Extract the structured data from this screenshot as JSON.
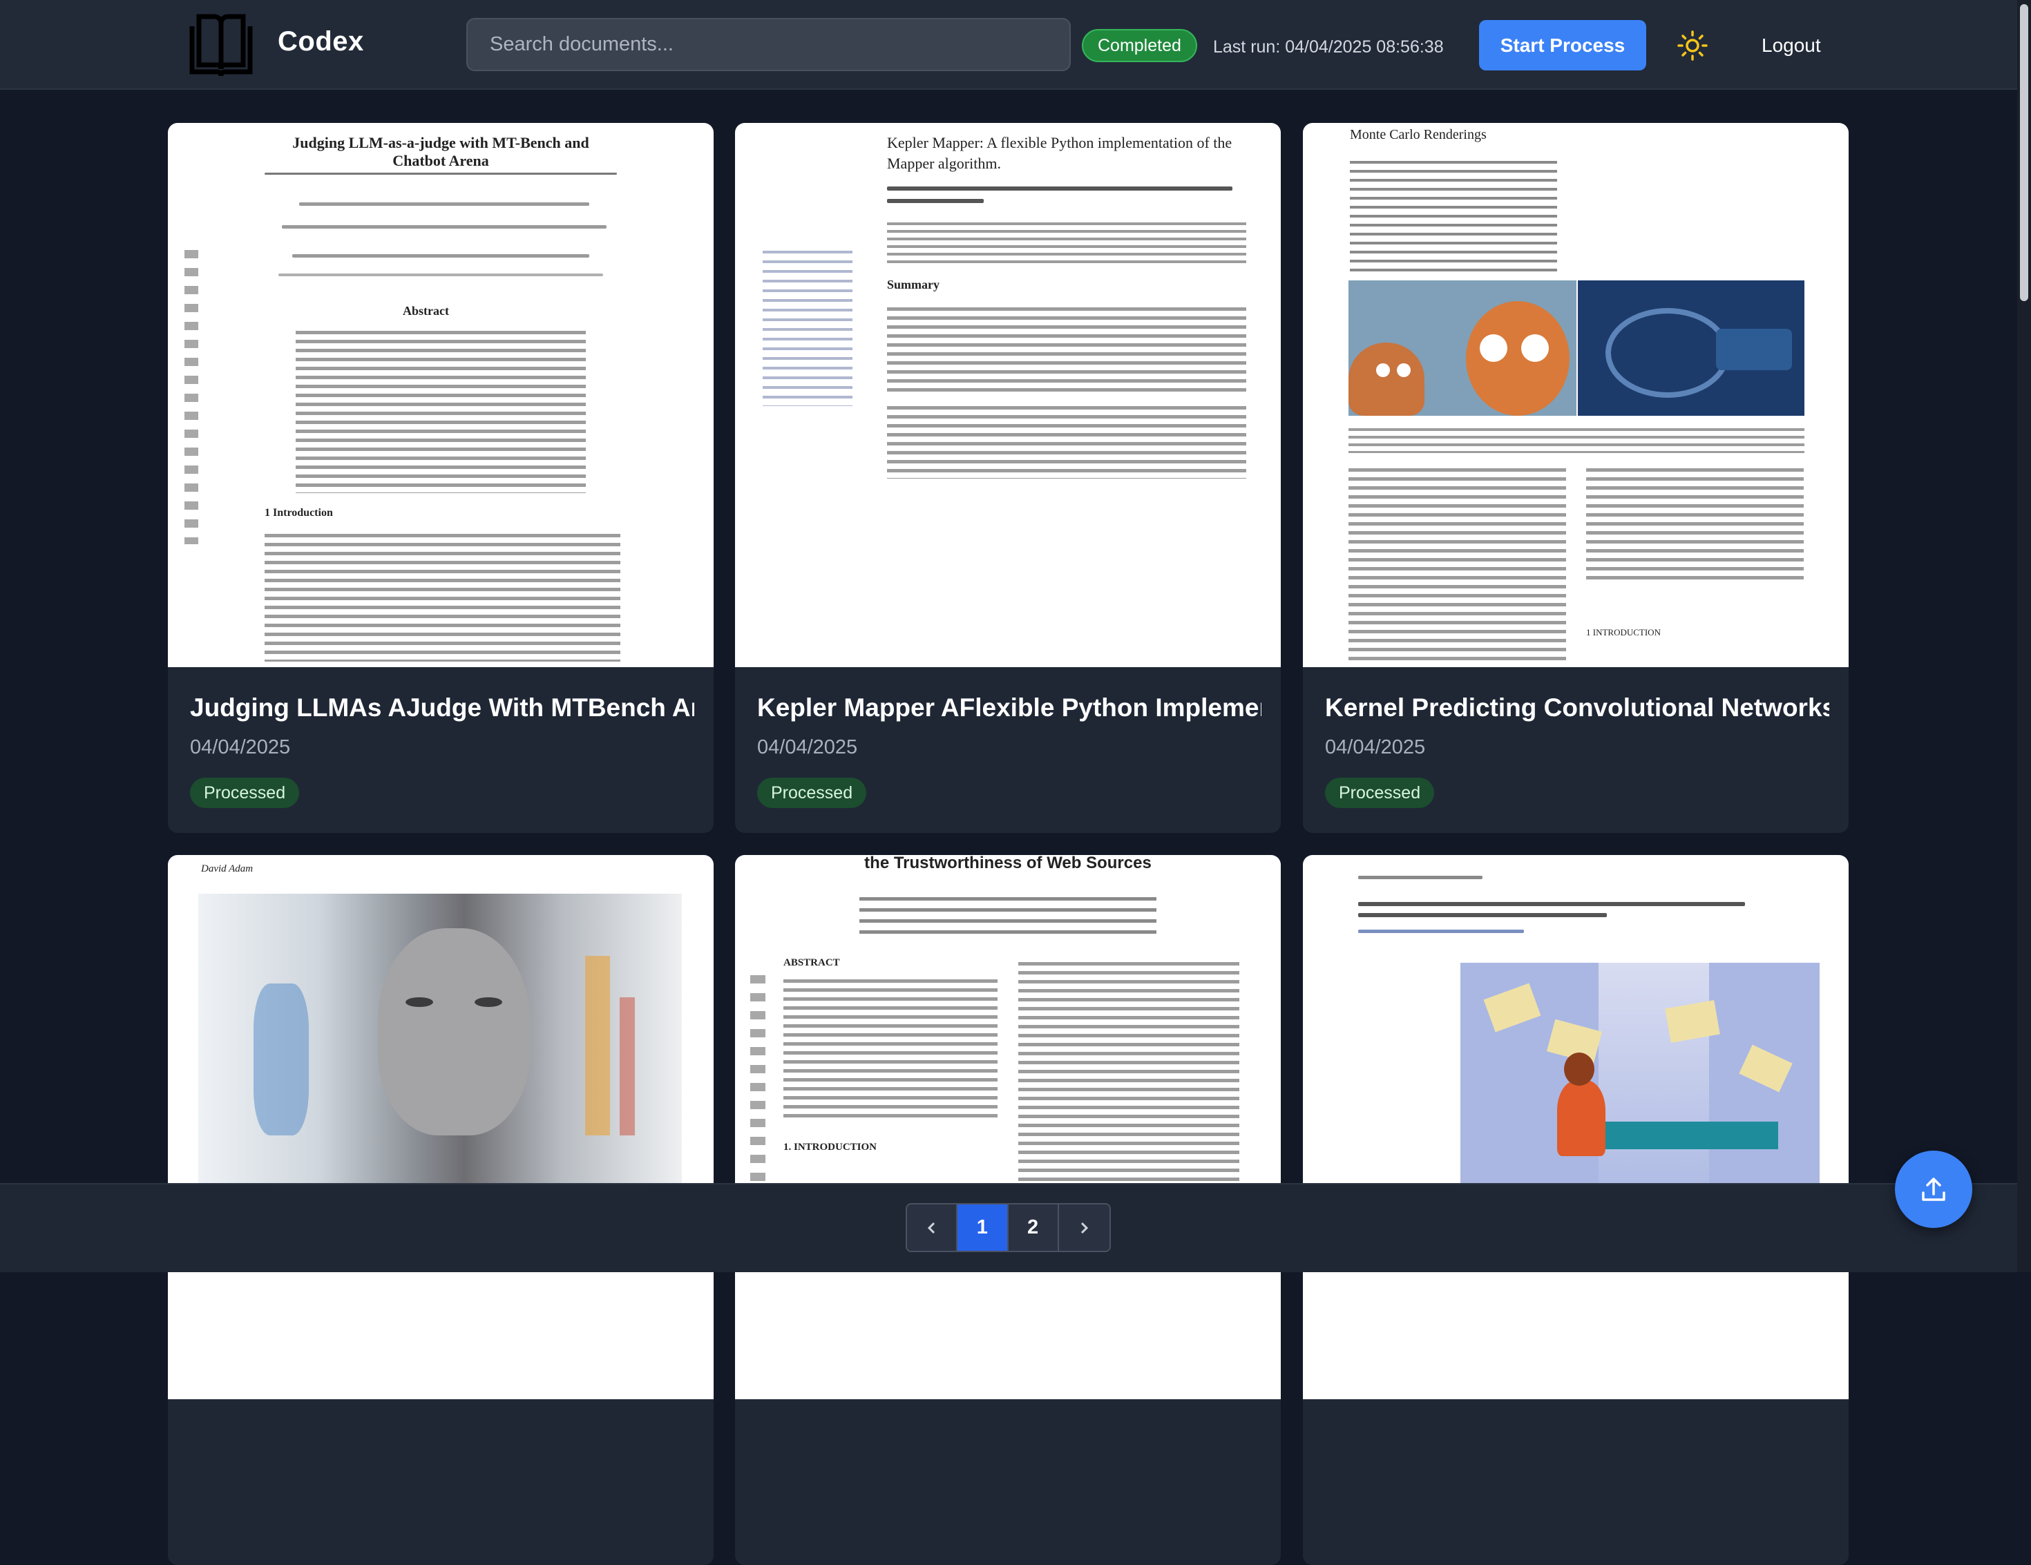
{
  "app": {
    "brand": "Codex",
    "search_placeholder": "Search documents...",
    "status": "Completed",
    "last_run": "Last run: 04/04/2025 08:56:38",
    "start_button": "Start Process",
    "logout": "Logout"
  },
  "cards": [
    {
      "title": "Judging LLMAs AJudge With MTBench An...",
      "date": "04/04/2025",
      "status": "Processed",
      "thumb_heading": "Judging LLM-as-a-judge with MT-Bench and Chatbot Arena",
      "thumb_section": "Abstract",
      "thumb_section2": "1 Introduction"
    },
    {
      "title": "Kepler Mapper AFlexible Python Implemen...",
      "date": "04/04/2025",
      "status": "Processed",
      "thumb_heading": "Kepler Mapper: A flexible Python implementation of the Mapper algorithm.",
      "thumb_section": "Summary"
    },
    {
      "title": "Kernel Predicting Convolutional Networks ...",
      "date": "04/04/2025",
      "status": "Processed",
      "thumb_heading": "Monte Carlo Renderings",
      "thumb_section": "1 INTRODUCTION"
    },
    {
      "title": "",
      "date": "",
      "status": "",
      "thumb_heading": "David Adam"
    },
    {
      "title": "",
      "date": "",
      "status": "",
      "thumb_heading": "the Trustworthiness of Web Sources",
      "thumb_section": "ABSTRACT",
      "thumb_section2": "1. INTRODUCTION"
    },
    {
      "title": "",
      "date": "",
      "status": "",
      "thumb_heading": ""
    }
  ],
  "pagination": {
    "prev": "‹",
    "pages": [
      "1",
      "2"
    ],
    "current": "1",
    "next": "›"
  },
  "icons": {
    "logo": "book-open-icon",
    "theme": "sun-icon",
    "upload": "upload-icon",
    "prev": "chevron-left-icon",
    "next": "chevron-right-icon"
  },
  "colors": {
    "background": "#121826",
    "header": "#222a38",
    "card": "#1f2735",
    "accent": "#3b82f6",
    "status_green": "#1f8a3c",
    "processed_badge": "#1b4d2e"
  }
}
